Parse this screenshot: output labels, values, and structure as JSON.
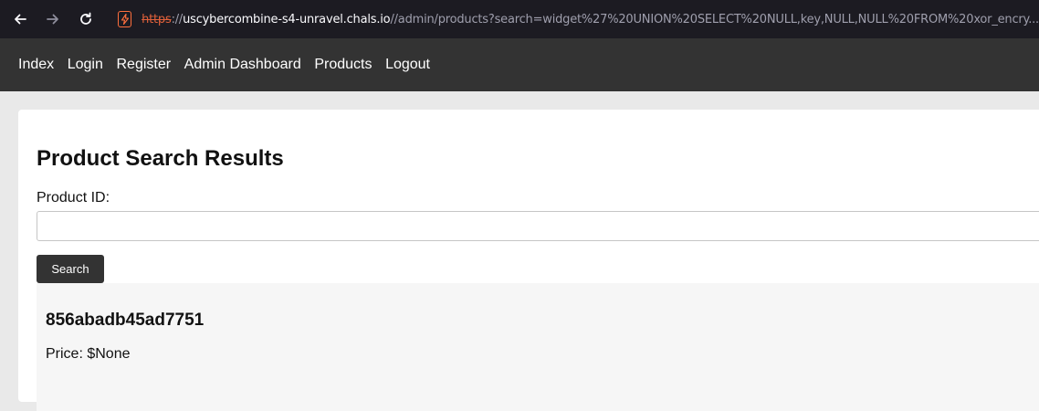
{
  "browser": {
    "url_scheme": "https",
    "url_sep": "://",
    "url_host": "uscybercombine-s4-unravel.chals.io",
    "url_path": "//admin/products?search=widget%27%20UNION%20SELECT%20NULL,key,NULL,NULL%20FROM%20xor_encry..."
  },
  "nav": {
    "items": [
      {
        "label": "Index"
      },
      {
        "label": "Login"
      },
      {
        "label": "Register"
      },
      {
        "label": "Admin Dashboard"
      },
      {
        "label": "Products"
      },
      {
        "label": "Logout"
      }
    ]
  },
  "page": {
    "title": "Product Search Results",
    "field_label": "Product ID:",
    "input_value": "",
    "search_label": "Search"
  },
  "results": [
    {
      "name": "856abadb45ad7751",
      "price": "Price: $None"
    }
  ]
}
